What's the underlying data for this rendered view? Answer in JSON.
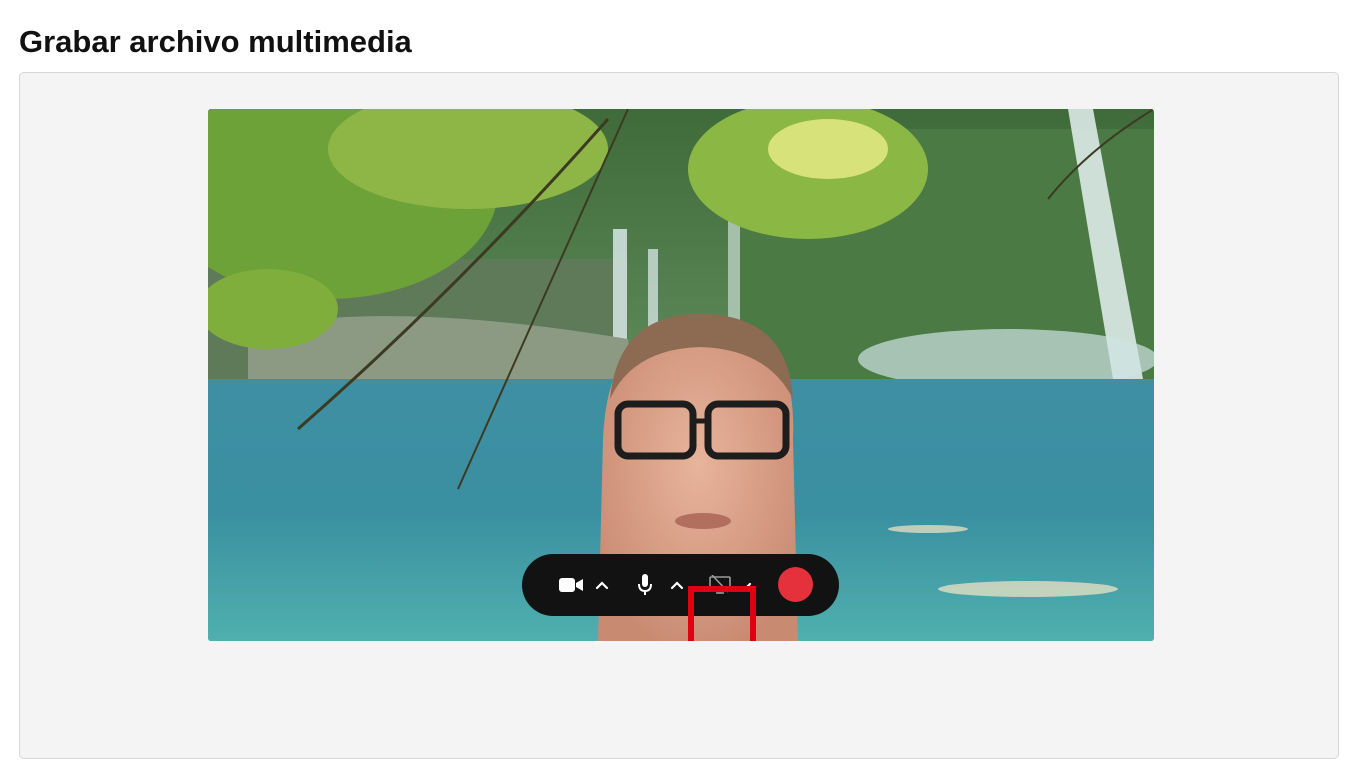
{
  "page": {
    "title": "Grabar archivo multimedia"
  },
  "controls": {
    "icons": [
      "video-camera-icon",
      "chevron-up-icon",
      "microphone-icon",
      "chevron-up-icon",
      "screen-share-off-icon",
      "chevron-up-icon",
      "record-button"
    ],
    "record_color": "#e5313c",
    "highlight_color": "#e0000f"
  }
}
